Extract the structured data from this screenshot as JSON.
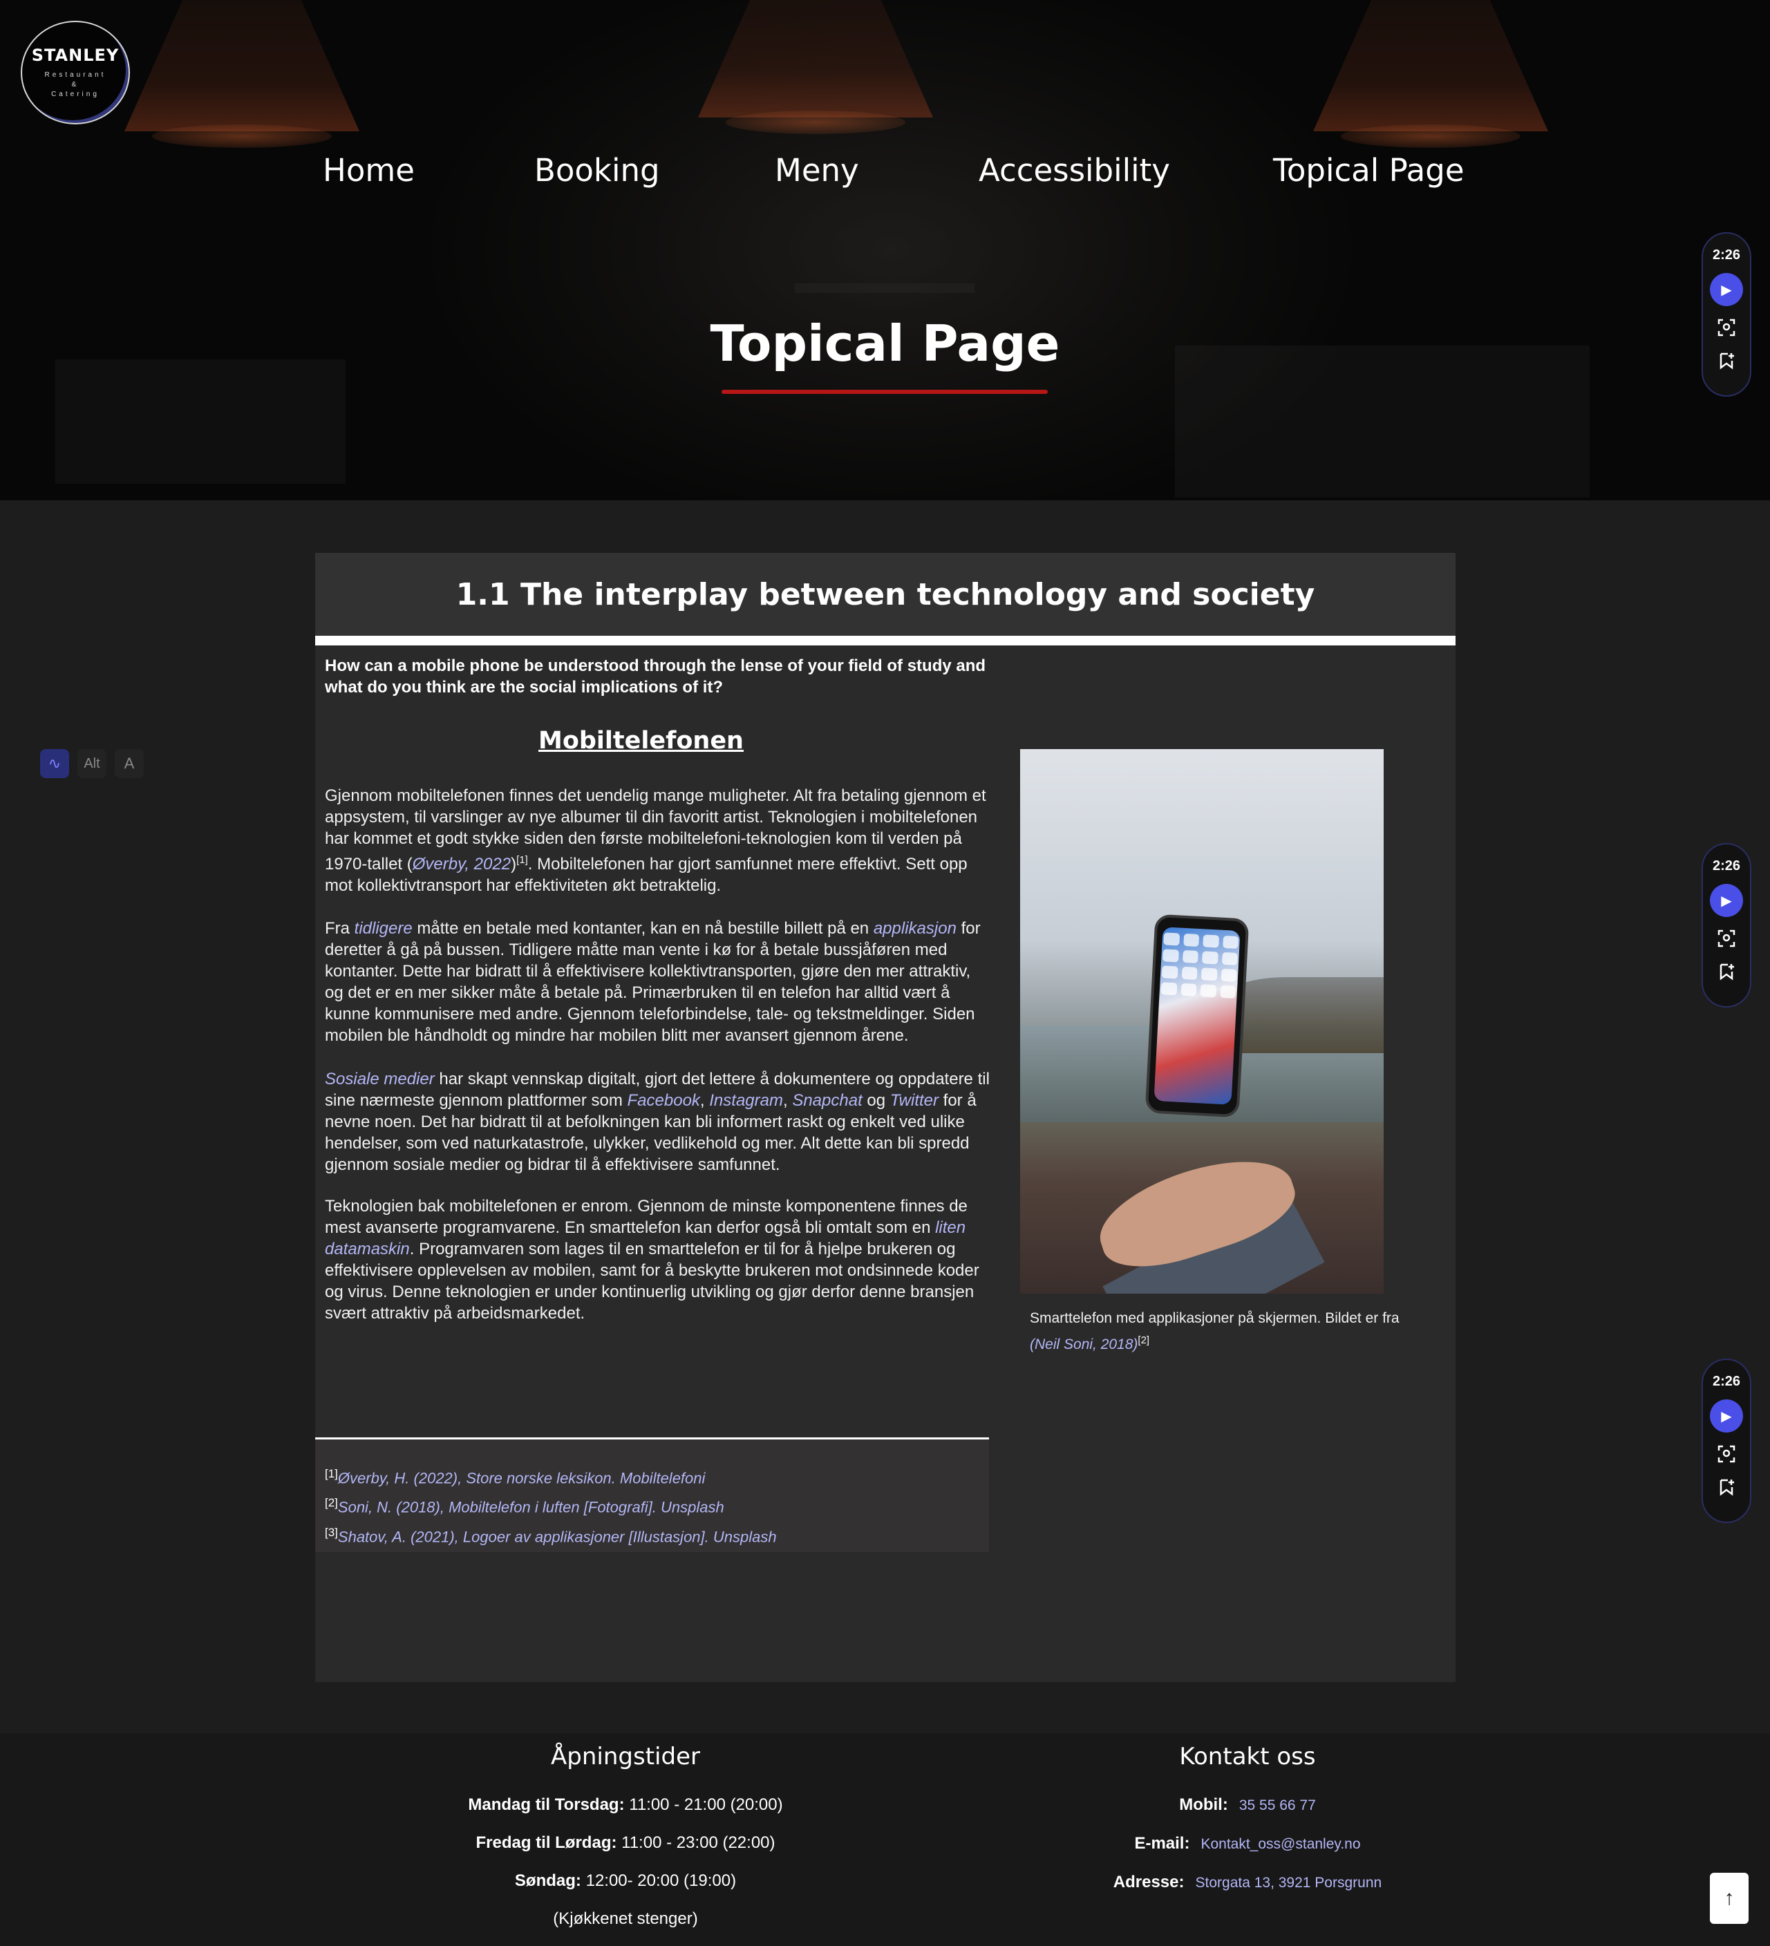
{
  "logo": {
    "brand": "STANLEY",
    "tagline_1": "Restaurant",
    "tagline_2": "&",
    "tagline_3": "Catering"
  },
  "nav": [
    {
      "label": "Home"
    },
    {
      "label": "Booking"
    },
    {
      "label": "Meny"
    },
    {
      "label": "Accessibility"
    },
    {
      "label": "Topical Page"
    }
  ],
  "hero": {
    "title": "Topical Page",
    "underline_color": "#b71616"
  },
  "players": [
    {
      "time": "2:26",
      "play_icon": "play-icon",
      "tool_1": "screen-scan-icon",
      "tool_2": "bookmark-add-icon"
    },
    {
      "time": "2:26",
      "play_icon": "play-icon",
      "tool_1": "screen-scan-icon",
      "tool_2": "bookmark-add-icon"
    },
    {
      "time": "2:26",
      "play_icon": "play-icon",
      "tool_1": "screen-scan-icon",
      "tool_2": "bookmark-add-icon"
    }
  ],
  "a11y_toolbar": {
    "wave": "audio-wave-icon",
    "alt": "Alt",
    "font": "A"
  },
  "article": {
    "heading": "1.1 The interplay between technology and society",
    "question": "How can a mobile phone be understood through the lense of your field of study and what do you think are the social implications of it?",
    "subheading": "Mobiltelefonen",
    "p1": {
      "a": "Gjennom mobiltelefonen finnes det uendelig mange muligheter. Alt fra betaling gjennom et appsystem, til varslinger av nye albumer til din favoritt artist. Teknologien i mobiltelefonen har kommet et godt stykke siden den første mobiltelefoni-teknologien kom til verden på 1970-tallet (",
      "link": "Øverby, 2022",
      "b": ")",
      "sup": "[1]",
      "c": ". Mobiltelefonen har gjort samfunnet mere effektivt. Sett opp mot kollektivtransport har effektiviteten økt betraktelig."
    },
    "p2": {
      "a": "Fra ",
      "link1": "tidligere",
      "b": " måtte en betale med kontanter, kan en nå bestille billett på en ",
      "link2": "applikasjon",
      "c": " for deretter å gå på bussen. Tidligere måtte man vente i kø for å betale bussjåføren med kontanter. Dette har bidratt til å effektivisere kollektivtransporten, gjøre den mer attraktiv, og det er en mer sikker måte å betale på. Primærbruken til en telefon har alltid vært å kunne kommunisere med andre. Gjennom teleforbindelse, tale- og tekstmeldinger. Siden mobilen ble håndholdt og mindre har mobilen blitt mer avansert gjennom årene."
    },
    "p3": {
      "link1": "Sosiale medier",
      "a": " har skapt vennskap digitalt, gjort det lettere å dokumentere og oppdatere til sine nærmeste gjennom plattformer som ",
      "link2": "Facebook",
      "sep1": ", ",
      "link3": "Instagram",
      "sep2": ", ",
      "link4": "Snapchat",
      "b": " og ",
      "link5": "Twitter",
      "c": " for å nevne noen. Det har bidratt til at befolkningen kan bli informert raskt og enkelt ved ulike hendelser, som ved naturkatastrofe, ulykker, vedlikehold og mer. Alt dette kan bli spredd gjennom sosiale medier og bidrar til å effektivisere samfunnet."
    },
    "p4": {
      "a": "Teknologien bak mobiltelefonen er enrom. Gjennom de minste komponentene finnes de mest avanserte programvarene. En smarttelefon kan derfor også bli omtalt som en ",
      "link": "liten datamaskin",
      "b": ". Programvaren som lages til en smarttelefon er til for å hjelpe brukeren og effektivisere opplevelsen av mobilen, samt for å beskytte brukeren mot ondsinnede koder og virus. Denne teknologien er under kontinuerlig utvikling og gjør derfor denne bransjen svært attraktiv på arbeidsmarkedet."
    },
    "caption": {
      "a": "Smarttelefon med applikasjoner på skjermen. Bildet er fra ",
      "link": "(Neil Soni, 2018)",
      "sup": "[2]"
    },
    "references": [
      {
        "num": "[1]",
        "text": "Øverby, H. (2022), Store norske leksikon. Mobiltelefoni"
      },
      {
        "num": "[2]",
        "text": "Soni, N. (2018), Mobiltelefon i luften [Fotografi]. Unsplash"
      },
      {
        "num": "[3]",
        "text": "Shatov, A. (2021), Logoer av applikasjoner [Illustasjon]. Unsplash"
      }
    ]
  },
  "footer": {
    "hours": {
      "title": "Åpningstider",
      "row1_label": "Mandag til Torsdag:",
      "row1_value": " 11:00 - 21:00 (20:00)",
      "row2_label": "Fredag til Lørdag:",
      "row2_value": " 11:00 - 23:00 (22:00)",
      "row3_label": "Søndag:",
      "row3_value": " 12:00- 20:00 (19:00)",
      "note": "(Kjøkkenet stenger)"
    },
    "contact": {
      "title": "Kontakt oss",
      "phone_label": "Mobil:",
      "phone": "35 55 66 77",
      "email_label": "E-mail:",
      "email": "Kontakt_oss@stanley.no",
      "address_label": "Adresse:",
      "address": "Storgata 13, 3921 Porsgrunn"
    }
  },
  "back_to_top": "↑"
}
